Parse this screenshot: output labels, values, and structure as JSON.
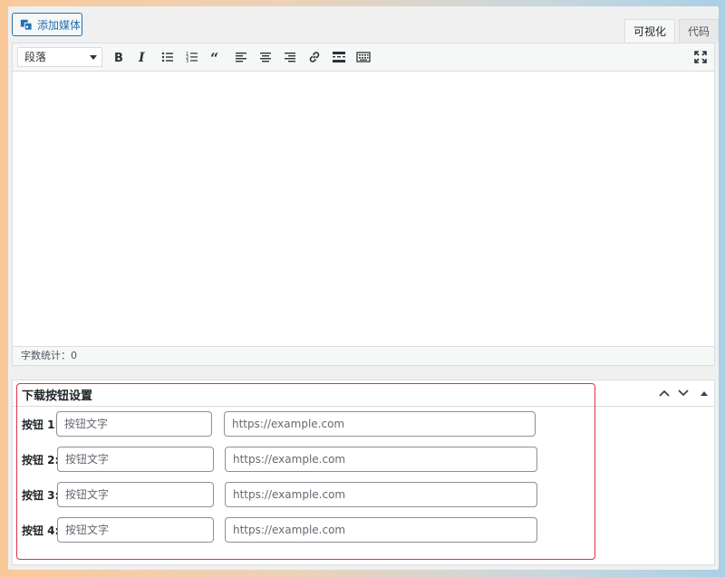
{
  "add_media": {
    "label": "添加媒体",
    "icon": "media-icon"
  },
  "tabs": [
    {
      "label": "可视化",
      "active": true
    },
    {
      "label": "代码",
      "active": false
    }
  ],
  "toolbar": {
    "format_value": "段落",
    "buttons": [
      "bold-icon",
      "italic-icon",
      "bullet-list-icon",
      "numbered-list-icon",
      "blockquote-icon",
      "align-left-icon",
      "align-center-icon",
      "align-right-icon",
      "link-icon",
      "read-more-icon",
      "toolbar-toggle-icon",
      "fullscreen-icon"
    ]
  },
  "status": {
    "word_count": "字数统计：0"
  },
  "metabox": {
    "title": "下载按钮设置",
    "rows": [
      {
        "label": "按钮 1:",
        "text_placeholder": "按钮文字",
        "url_placeholder": "https://example.com"
      },
      {
        "label": "按钮 2:",
        "text_placeholder": "按钮文字",
        "url_placeholder": "https://example.com"
      },
      {
        "label": "按钮 3:",
        "text_placeholder": "按钮文字",
        "url_placeholder": "https://example.com"
      },
      {
        "label": "按钮 4:",
        "text_placeholder": "按钮文字",
        "url_placeholder": "https://example.com"
      }
    ]
  },
  "colors": {
    "accent": "#2271b1",
    "highlight": "#e0314b"
  }
}
